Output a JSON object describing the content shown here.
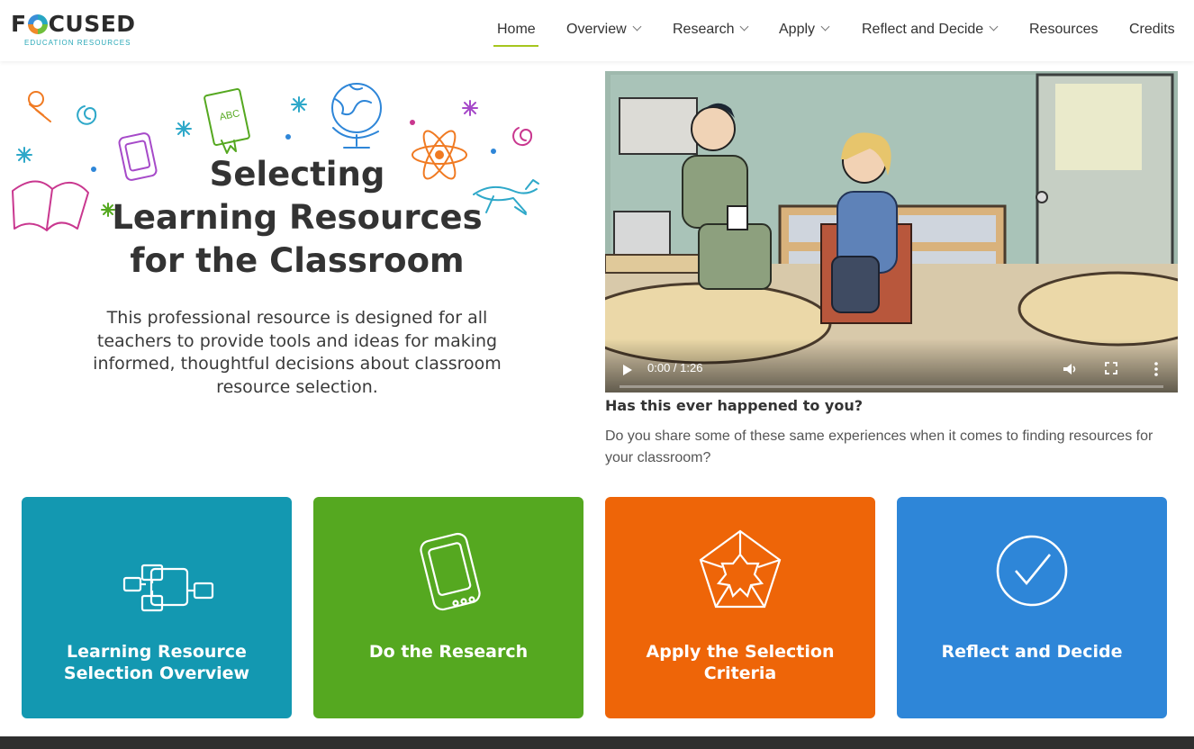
{
  "logo": {
    "main_before": "F",
    "main_after": "CUSED",
    "sub": "EDUCATION RESOURCES"
  },
  "nav": {
    "items": [
      {
        "label": "Home",
        "dropdown": false,
        "active": true
      },
      {
        "label": "Overview",
        "dropdown": true
      },
      {
        "label": "Research",
        "dropdown": true
      },
      {
        "label": "Apply",
        "dropdown": true
      },
      {
        "label": "Reflect and Decide",
        "dropdown": true
      },
      {
        "label": "Resources",
        "dropdown": false
      },
      {
        "label": "Credits",
        "dropdown": false
      }
    ],
    "accent_color": "#a6c61e"
  },
  "hero": {
    "title_lines": [
      "Selecting",
      "Learning Resources",
      "for the Classroom"
    ],
    "description_lines": [
      "This professional resource is designed for all",
      "teachers to provide tools and ideas for making",
      "informed, thoughtful decisions about classroom",
      "resource selection."
    ],
    "decorations": [
      "push-pin-icon",
      "spiral-icon",
      "tablet-icon",
      "book-icon",
      "globe-icon",
      "atom-icon",
      "frog-icon",
      "open-book-icon"
    ]
  },
  "video": {
    "time": "0:00 / 1:26",
    "progress": 0.0,
    "heading": "Has this ever happened to you?",
    "description": "Do you share some of these same experiences when it comes to finding resources for your classroom?"
  },
  "cards": [
    {
      "label_lines": [
        "Learning Resource",
        "Selection Overview"
      ],
      "icon": "flowchart-icon",
      "color": "#1398b1"
    },
    {
      "label_lines": [
        "Do the Research"
      ],
      "icon": "tablet-icon",
      "color": "#55a820"
    },
    {
      "label_lines": [
        "Apply the Selection",
        "Criteria"
      ],
      "icon": "pentagon-icon",
      "color": "#ee6508"
    },
    {
      "label_lines": [
        "Reflect and Decide"
      ],
      "icon": "checkmark-circle-icon",
      "color": "#2e86d8"
    }
  ]
}
